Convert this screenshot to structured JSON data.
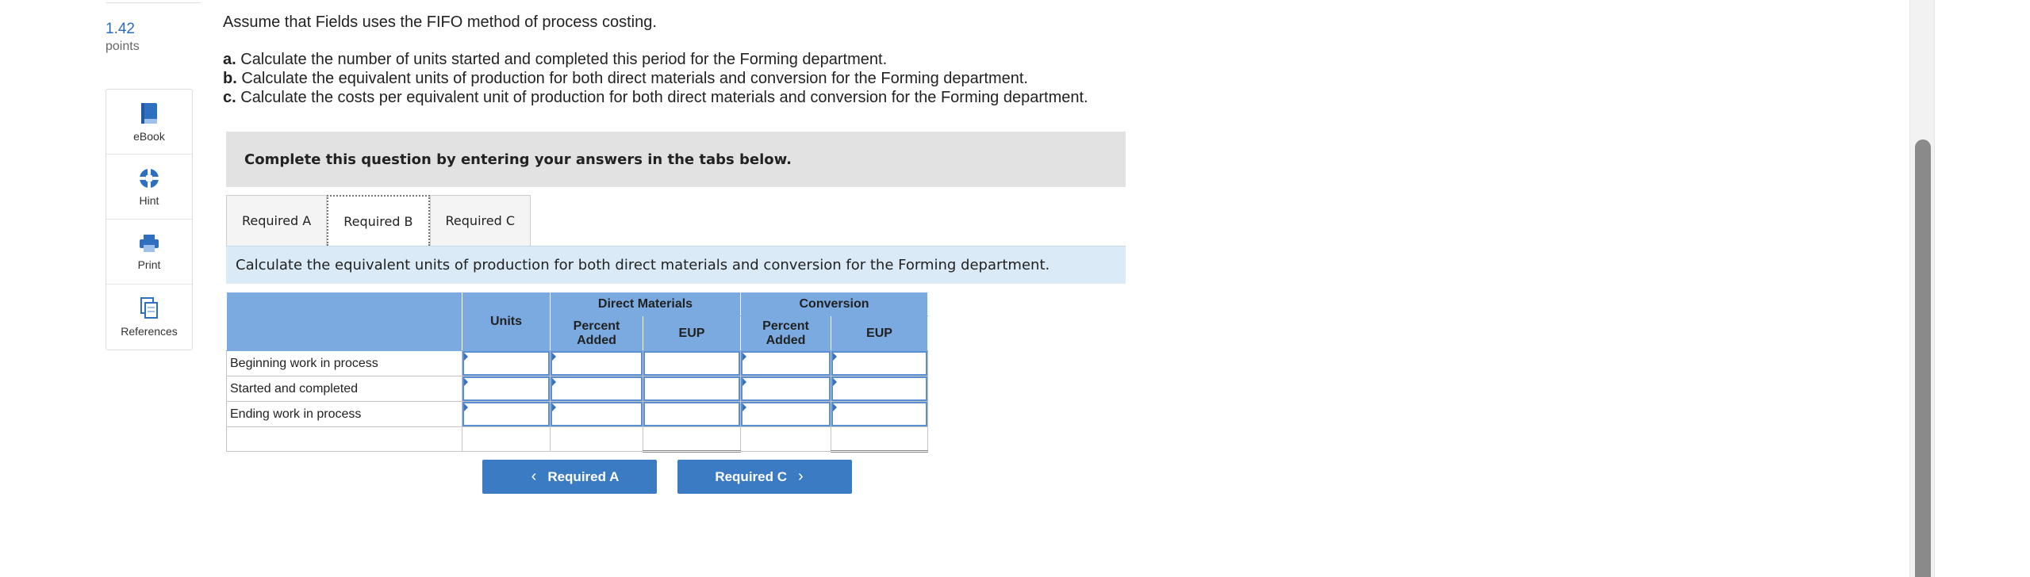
{
  "sidebar": {
    "points_value": "1.42",
    "points_label": "points",
    "tools": [
      {
        "label": "eBook",
        "icon": "book-icon"
      },
      {
        "label": "Hint",
        "icon": "lifebuoy-icon"
      },
      {
        "label": "Print",
        "icon": "printer-icon"
      },
      {
        "label": "References",
        "icon": "documents-icon"
      }
    ]
  },
  "question": {
    "intro": "Assume that Fields uses the FIFO method of process costing.",
    "parts": [
      {
        "letter": "a.",
        "text": " Calculate the number of units started and completed this period for the Forming department."
      },
      {
        "letter": "b.",
        "text": " Calculate the equivalent units of production for both direct materials and conversion for the Forming department."
      },
      {
        "letter": "c.",
        "text": " Calculate the costs per equivalent unit of production for both direct materials and conversion for the Forming department."
      }
    ]
  },
  "banner": "Complete this question by entering your answers in the tabs below.",
  "tabs": [
    {
      "label": "Required A",
      "active": false
    },
    {
      "label": "Required B",
      "active": true
    },
    {
      "label": "Required C",
      "active": false
    }
  ],
  "panel_instruction": "Calculate the equivalent units of production for both direct materials and conversion for the Forming department.",
  "table": {
    "headers": {
      "units": "Units",
      "direct_materials": "Direct Materials",
      "conversion": "Conversion",
      "percent_added_1": "Percent",
      "percent_added_2": "Added",
      "eup": "EUP"
    },
    "rows": [
      {
        "label": "Beginning work in process"
      },
      {
        "label": "Started and completed"
      },
      {
        "label": "Ending work in process"
      },
      {
        "label": ""
      }
    ]
  },
  "nav": {
    "prev_label": "Required A",
    "next_label": "Required C",
    "prev_glyph": "‹",
    "next_glyph": "›"
  },
  "colors": {
    "accent": "#3b7bc4",
    "table_header": "#7aaae0",
    "panel_bg": "#dbeaf7",
    "banner_bg": "#e2e2e2"
  }
}
